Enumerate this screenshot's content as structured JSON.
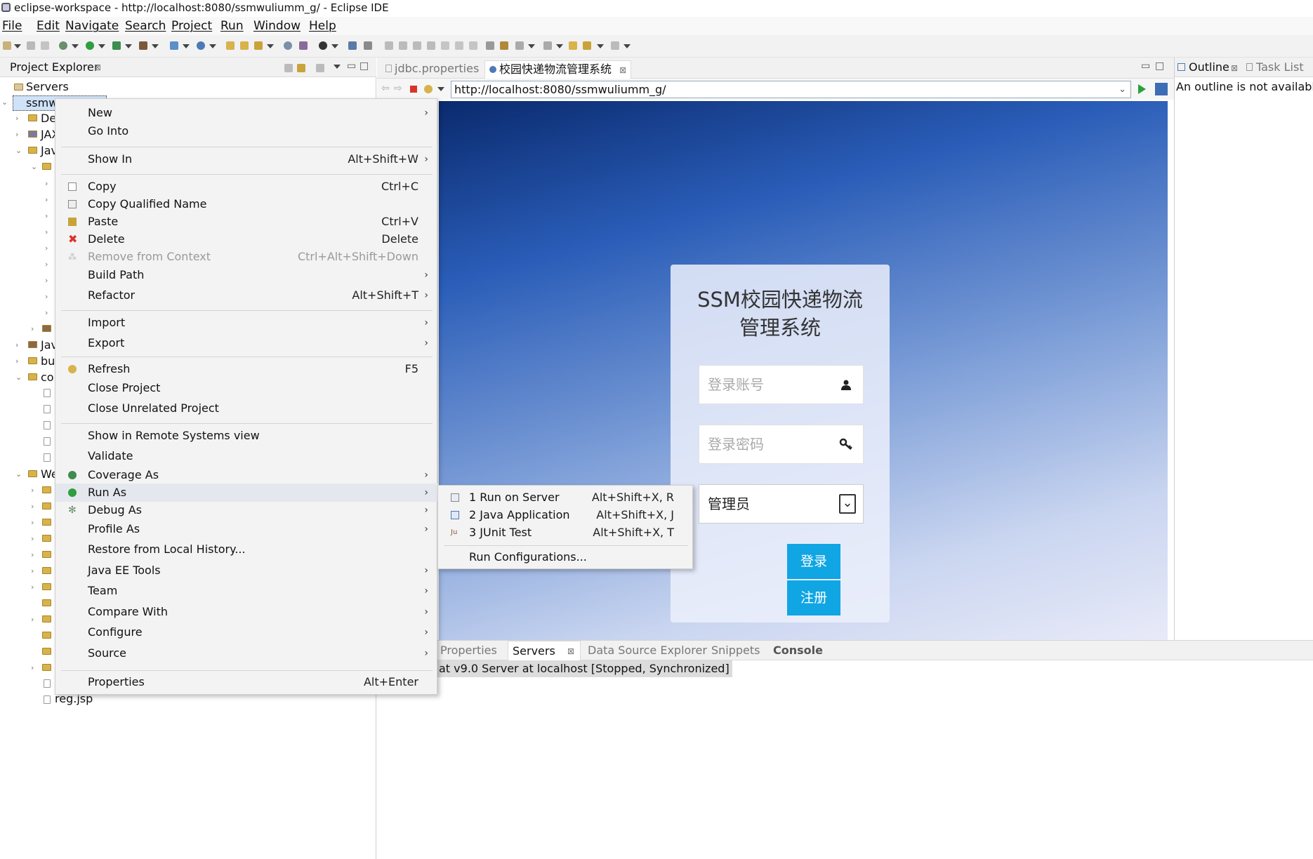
{
  "window": {
    "title": "eclipse-workspace - http://localhost:8080/ssmwuliumm_g/ - Eclipse IDE"
  },
  "menubar": [
    "File",
    "Edit",
    "Navigate",
    "Search",
    "Project",
    "Run",
    "Window",
    "Help"
  ],
  "project_explorer": {
    "title": "Project Explorer",
    "close": "⊠",
    "tree": [
      {
        "label": "Servers"
      },
      {
        "label": "ssmw"
      },
      {
        "label": "De"
      },
      {
        "label": "JAX"
      },
      {
        "label": "Jav"
      },
      {
        "label": "Jav"
      },
      {
        "label": "bu"
      },
      {
        "label": "cor"
      },
      {
        "label": "We"
      },
      {
        "label": "reg.jsp"
      }
    ]
  },
  "editor": {
    "tabs": [
      {
        "label": "jdbc.properties"
      },
      {
        "label": "校园快递物流管理系统",
        "close": "⊠"
      }
    ],
    "url": "http://localhost:8080/ssmwuliumm_g/"
  },
  "login": {
    "title_line1": "SSM校园快递物流",
    "title_line2": "管理系统",
    "account_placeholder": "登录账号",
    "password_placeholder": "登录密码",
    "role_selected": "管理员",
    "login_button": "登录",
    "register_button": "注册"
  },
  "outline": {
    "tab_outline": "Outline",
    "tab_close": "⊠",
    "tab_tasklist": "Task List",
    "message": "An outline is not available."
  },
  "bottom": {
    "tabs": [
      "Properties",
      "Servers",
      "Data Source Explorer",
      "Snippets",
      "Console"
    ],
    "servers_close": "⊠",
    "server_row": "at v9.0 Server at localhost  [Stopped, Synchronized]"
  },
  "context_menu": {
    "items": [
      {
        "label": "New",
        "accel": "",
        "submenu": true
      },
      {
        "label": "Go Into",
        "accel": "",
        "submenu": false
      },
      {
        "label": "Show In",
        "accel": "Alt+Shift+W",
        "submenu": true
      },
      {
        "label": "Copy",
        "accel": "Ctrl+C",
        "submenu": false
      },
      {
        "label": "Copy Qualified Name",
        "accel": "",
        "submenu": false
      },
      {
        "label": "Paste",
        "accel": "Ctrl+V",
        "submenu": false
      },
      {
        "label": "Delete",
        "accel": "Delete",
        "submenu": false
      },
      {
        "label": "Remove from Context",
        "accel": "Ctrl+Alt+Shift+Down",
        "submenu": false,
        "disabled": true
      },
      {
        "label": "Build Path",
        "accel": "",
        "submenu": true
      },
      {
        "label": "Refactor",
        "accel": "Alt+Shift+T",
        "submenu": true
      },
      {
        "label": "Import",
        "accel": "",
        "submenu": true
      },
      {
        "label": "Export",
        "accel": "",
        "submenu": true
      },
      {
        "label": "Refresh",
        "accel": "F5",
        "submenu": false
      },
      {
        "label": "Close Project",
        "accel": "",
        "submenu": false
      },
      {
        "label": "Close Unrelated Project",
        "accel": "",
        "submenu": false
      },
      {
        "label": "Show in Remote Systems view",
        "accel": "",
        "submenu": false
      },
      {
        "label": "Validate",
        "accel": "",
        "submenu": false
      },
      {
        "label": "Coverage As",
        "accel": "",
        "submenu": true
      },
      {
        "label": "Run As",
        "accel": "",
        "submenu": true,
        "highlighted": true
      },
      {
        "label": "Debug As",
        "accel": "",
        "submenu": true
      },
      {
        "label": "Profile As",
        "accel": "",
        "submenu": true
      },
      {
        "label": "Restore from Local History...",
        "accel": "",
        "submenu": false
      },
      {
        "label": "Java EE Tools",
        "accel": "",
        "submenu": true
      },
      {
        "label": "Team",
        "accel": "",
        "submenu": true
      },
      {
        "label": "Compare With",
        "accel": "",
        "submenu": true
      },
      {
        "label": "Configure",
        "accel": "",
        "submenu": true
      },
      {
        "label": "Source",
        "accel": "",
        "submenu": true
      },
      {
        "label": "Properties",
        "accel": "Alt+Enter",
        "submenu": false
      }
    ]
  },
  "run_as_submenu": {
    "items": [
      {
        "label": "1 Run on Server",
        "accel": "Alt+Shift+X, R"
      },
      {
        "label": "2 Java Application",
        "accel": "Alt+Shift+X, J"
      },
      {
        "label": "3 JUnit Test",
        "accel": "Alt+Shift+X, T"
      },
      {
        "label": "Run Configurations...",
        "accel": ""
      }
    ]
  },
  "colors": {
    "accent_button": "#10a5e3",
    "delete_icon": "#d9342b",
    "run_icon": "#2e9e3e"
  }
}
